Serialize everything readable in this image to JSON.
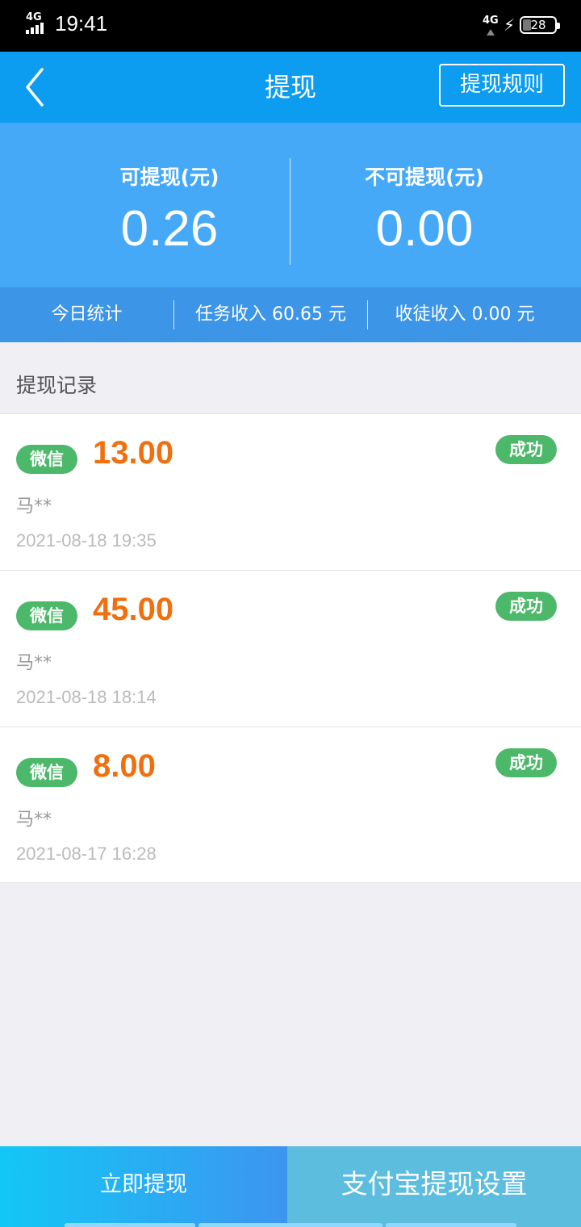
{
  "status_bar": {
    "network_left": "4G",
    "time": "19:41",
    "network_right": "4G",
    "battery_level": "28"
  },
  "nav": {
    "back_icon": "chevron-left-icon",
    "title": "提现",
    "rules_button": "提现规则"
  },
  "balance": {
    "withdrawable_label": "可提现(元)",
    "withdrawable_value": "0.26",
    "non_withdrawable_label": "不可提现(元)",
    "non_withdrawable_value": "0.00"
  },
  "today_stats": {
    "label": "今日统计",
    "task_income": "任务收入 60.65 元",
    "apprentice_income": "收徒收入 0.00 元"
  },
  "records": {
    "header": "提现记录",
    "items": [
      {
        "channel": "微信",
        "amount": "13.00",
        "status": "成功",
        "name": "马**",
        "time": "2021-08-18 19:35"
      },
      {
        "channel": "微信",
        "amount": "45.00",
        "status": "成功",
        "name": "马**",
        "time": "2021-08-18 18:14"
      },
      {
        "channel": "微信",
        "amount": "8.00",
        "status": "成功",
        "name": "马**",
        "time": "2021-08-17 16:28"
      }
    ]
  },
  "bottom": {
    "withdraw_now": "立即提现",
    "alipay_settings": "支付宝提现设置"
  },
  "colors": {
    "nav_blue": "#0c9cf0",
    "balance_blue": "#45a9f8",
    "amount_orange": "#f07010",
    "success_green": "#4cb86a"
  }
}
